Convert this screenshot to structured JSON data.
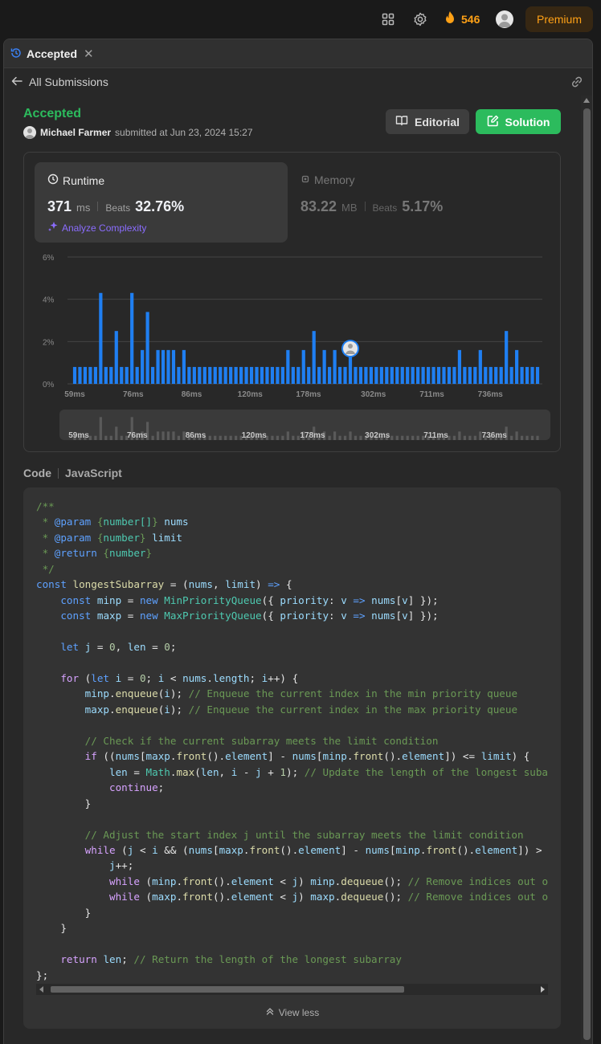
{
  "topnav": {
    "icons": [
      "grid-icon",
      "gear-icon",
      "fire-icon",
      "avatar"
    ],
    "streak": "546",
    "premium_label": "Premium"
  },
  "tab": {
    "label": "Accepted",
    "icon": "history-icon"
  },
  "back": {
    "label": "All Submissions"
  },
  "submission": {
    "status": "Accepted",
    "user": "Michael Farmer",
    "submitted_text": "submitted at Jun 23, 2024 15:27",
    "editorial_label": "Editorial",
    "solution_label": "Solution"
  },
  "runtime": {
    "title": "Runtime",
    "value": "371",
    "unit": "ms",
    "beats_label": "Beats",
    "beats": "32.76%",
    "analyze_label": "Analyze Complexity"
  },
  "memory": {
    "title": "Memory",
    "value": "83.22",
    "unit": "MB",
    "beats_label": "Beats",
    "beats": "5.17%"
  },
  "chart_data": {
    "type": "bar",
    "ylim": [
      0,
      6
    ],
    "yticks": [
      "6%",
      "4%",
      "2%",
      "0%"
    ],
    "xlabels": [
      "59ms",
      "76ms",
      "86ms",
      "120ms",
      "178ms",
      "302ms",
      "711ms",
      "736ms"
    ],
    "values": [
      0.8,
      0.8,
      0.8,
      0.8,
      0.8,
      4.3,
      0.8,
      0.8,
      2.5,
      0.8,
      0.8,
      4.3,
      0.8,
      1.6,
      3.4,
      0.8,
      1.6,
      1.6,
      1.6,
      1.6,
      0.8,
      1.6,
      0.8,
      0.8,
      0.8,
      0.8,
      0.8,
      0.8,
      0.8,
      0.8,
      0.8,
      0.8,
      0.8,
      0.8,
      0.8,
      0.8,
      0.8,
      0.8,
      0.8,
      0.8,
      0.8,
      1.6,
      0.8,
      0.8,
      1.6,
      0.8,
      2.5,
      0.8,
      1.6,
      0.8,
      1.6,
      0.8,
      0.8,
      1.6,
      0.8,
      0.8,
      0.8,
      0.8,
      0.8,
      0.8,
      0.8,
      0.8,
      0.8,
      0.8,
      0.8,
      0.8,
      0.8,
      0.8,
      0.8,
      0.8,
      0.8,
      0.8,
      0.8,
      0.8,
      1.6,
      0.8,
      0.8,
      0.8,
      1.6,
      0.8,
      0.8,
      0.8,
      0.8,
      2.5,
      0.8,
      1.6,
      0.8,
      0.8,
      0.8,
      0.8
    ],
    "bar_color": "#1f7ff2",
    "minimap_color": "#5a5a5a",
    "marker_index": 53
  },
  "code": {
    "label": "Code",
    "language": "JavaScript",
    "view_less": "View less"
  }
}
